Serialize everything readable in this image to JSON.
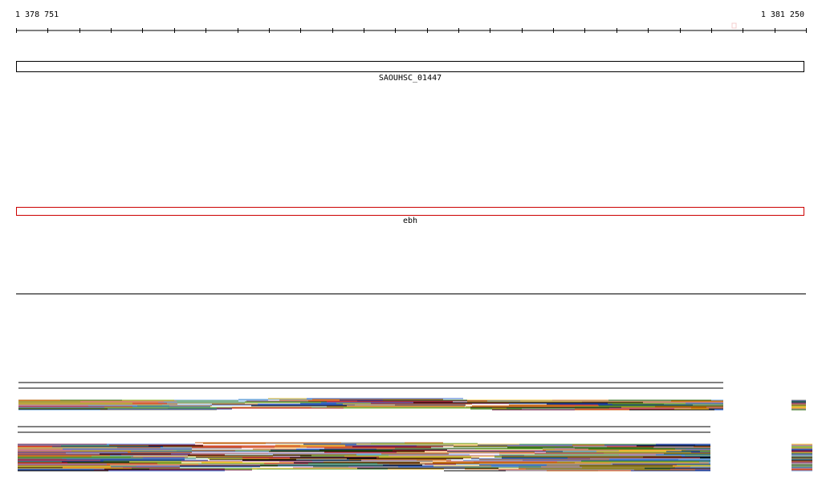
{
  "ruler": {
    "start_label": "1 378 751",
    "end_label": "1 381 250",
    "range_start": 1378751,
    "range_end": 1381250
  },
  "features": {
    "gene": {
      "label": "SAOUHSC_01447",
      "outline_color": "#000000"
    },
    "protein": {
      "label": "ebh",
      "outline_color": "#cc0000"
    }
  },
  "alignment_palette": [
    "#1f3f99",
    "#3b6fd1",
    "#6fa8dc",
    "#999999",
    "#cc3333",
    "#d2691e",
    "#e69138",
    "#b45f06",
    "#8fbc3f",
    "#6aa84f",
    "#38761d",
    "#c27ba0",
    "#741b47",
    "#000000",
    "#f1c232"
  ]
}
